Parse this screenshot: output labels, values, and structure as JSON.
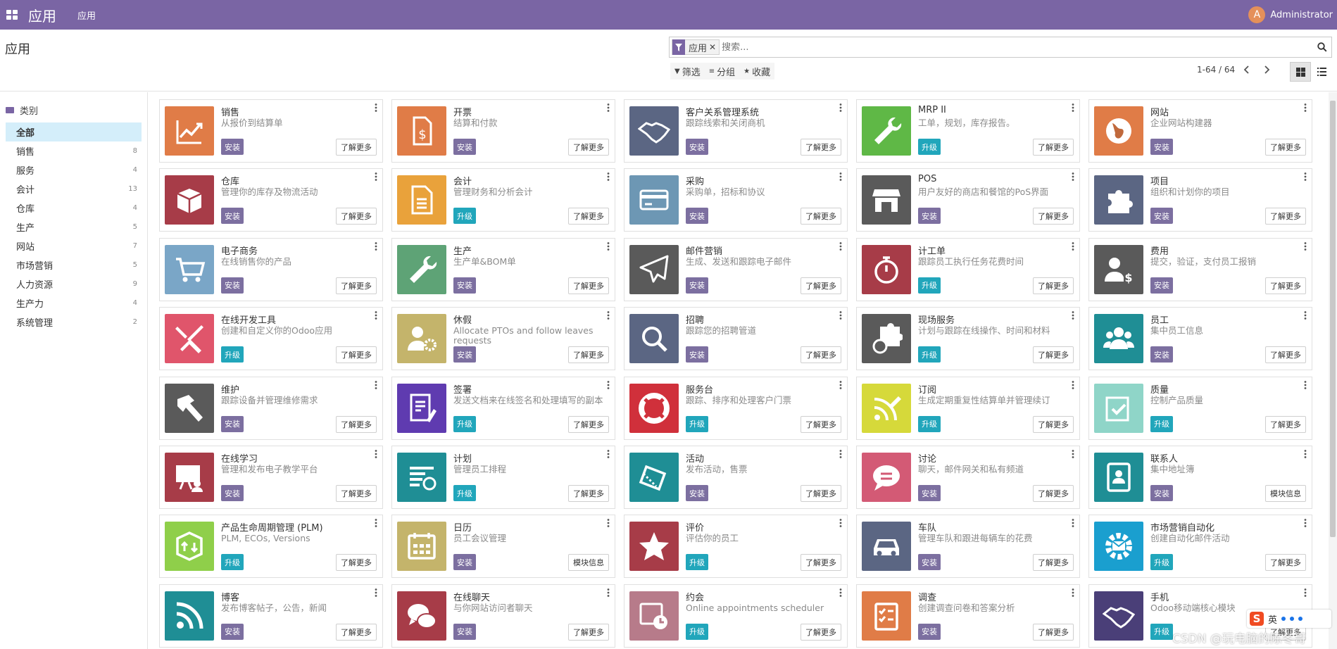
{
  "navbar": {
    "brand": "应用",
    "menu": "应用",
    "user_initial": "A",
    "user_name": "Administrator"
  },
  "control_panel": {
    "title": "应用",
    "facet_label": "应用",
    "facet_close": "✕",
    "search_placeholder": "搜索...",
    "filters": [
      {
        "icon": "▼",
        "label": "筛选"
      },
      {
        "icon": "≡",
        "label": "分组"
      },
      {
        "icon": "★",
        "label": "收藏"
      }
    ],
    "pager": "1-64 / 64"
  },
  "sidebar": {
    "header": "类别",
    "items": [
      {
        "label": "全部",
        "count": ""
      },
      {
        "label": "销售",
        "count": "8"
      },
      {
        "label": "服务",
        "count": "4"
      },
      {
        "label": "会计",
        "count": "13"
      },
      {
        "label": "仓库",
        "count": "4"
      },
      {
        "label": "生产",
        "count": "5"
      },
      {
        "label": "网站",
        "count": "7"
      },
      {
        "label": "市场营销",
        "count": "5"
      },
      {
        "label": "人力资源",
        "count": "9"
      },
      {
        "label": "生产力",
        "count": "4"
      },
      {
        "label": "系统管理",
        "count": "2"
      }
    ]
  },
  "apps": [
    {
      "name": "销售",
      "desc": "从报价到结算单",
      "action": "安装",
      "link": "了解更多",
      "icon": "chart-trend-icon",
      "color": "#e07c47"
    },
    {
      "name": "开票",
      "desc": "结算和付款",
      "action": "安装",
      "link": "了解更多",
      "icon": "invoice-dollar-icon",
      "color": "#e07c47"
    },
    {
      "name": "客户关系管理系统",
      "desc": "跟踪线索和关闭商机",
      "action": "安装",
      "link": "了解更多",
      "icon": "handshake-icon",
      "color": "#5b6683"
    },
    {
      "name": "MRP II",
      "desc": "工单，规划，库存报告。",
      "action": "升级",
      "link": "了解更多",
      "icon": "wrench-icon",
      "color": "#5fb846"
    },
    {
      "name": "网站",
      "desc": "企业网站构建器",
      "action": "安装",
      "link": "了解更多",
      "icon": "globe-icon",
      "color": "#e07c47"
    },
    {
      "name": "仓库",
      "desc": "管理你的库存及物流活动",
      "action": "安装",
      "link": "了解更多",
      "icon": "box-icon",
      "color": "#a73c48"
    },
    {
      "name": "会计",
      "desc": "管理财务和分析会计",
      "action": "升级",
      "link": "了解更多",
      "icon": "document-icon",
      "color": "#e9a23b"
    },
    {
      "name": "采购",
      "desc": "采购单，招标和协议",
      "action": "安装",
      "link": "了解更多",
      "icon": "credit-card-icon",
      "color": "#6d97b4"
    },
    {
      "name": "POS",
      "desc": "用户友好的商店和餐馆的PoS界面",
      "action": "安装",
      "link": "了解更多",
      "icon": "shop-icon",
      "color": "#5a5a5a"
    },
    {
      "name": "项目",
      "desc": "组织和计划你的项目",
      "action": "安装",
      "link": "了解更多",
      "icon": "puzzle-icon",
      "color": "#5b6683"
    },
    {
      "name": "电子商务",
      "desc": "在线销售你的产品",
      "action": "安装",
      "link": "了解更多",
      "icon": "shopping-cart-icon",
      "color": "#7aa6c7"
    },
    {
      "name": "生产",
      "desc": "生产单&BOM单",
      "action": "安装",
      "link": "了解更多",
      "icon": "wrench-icon",
      "color": "#5ea376"
    },
    {
      "name": "邮件营销",
      "desc": "生成、发送和跟踪电子邮件",
      "action": "安装",
      "link": "了解更多",
      "icon": "paper-plane-icon",
      "color": "#5a5a5a"
    },
    {
      "name": "计工单",
      "desc": "跟踪员工执行任务花费时间",
      "action": "升级",
      "link": "了解更多",
      "icon": "stopwatch-icon",
      "color": "#a73c48"
    },
    {
      "name": "费用",
      "desc": "提交，验证，支付员工报销",
      "action": "安装",
      "link": "了解更多",
      "icon": "user-dollar-icon",
      "color": "#5a5a5a"
    },
    {
      "name": "在线开发工具",
      "desc": "创建和自定义你的Odoo应用",
      "action": "升级",
      "link": "了解更多",
      "icon": "tools-icon",
      "color": "#e0556b"
    },
    {
      "name": "休假",
      "desc": "Allocate PTOs and follow leaves requests",
      "action": "安装",
      "link": "了解更多",
      "icon": "user-gear-icon",
      "color": "#c4b46b"
    },
    {
      "name": "招聘",
      "desc": "跟踪您的招聘管道",
      "action": "安装",
      "link": "了解更多",
      "icon": "magnifier-icon",
      "color": "#5b6683"
    },
    {
      "name": "现场服务",
      "desc": "计划与跟踪在线操作、时间和材料",
      "action": "升级",
      "link": "了解更多",
      "icon": "puzzle-clock-icon",
      "color": "#5a5a5a"
    },
    {
      "name": "员工",
      "desc": "集中员工信息",
      "action": "安装",
      "link": "了解更多",
      "icon": "users-icon",
      "color": "#1f8e95"
    },
    {
      "name": "维护",
      "desc": "跟踪设备并管理维修需求",
      "action": "安装",
      "link": "了解更多",
      "icon": "hammer-icon",
      "color": "#5a5a5a"
    },
    {
      "name": "签署",
      "desc": "发送文档来在线签名和处理填写的副本",
      "action": "升级",
      "link": "了解更多",
      "icon": "sign-document-icon",
      "color": "#5f3bb0"
    },
    {
      "name": "服务台",
      "desc": "跟踪、排序和处理客户门票",
      "action": "升级",
      "link": "了解更多",
      "icon": "lifebuoy-icon",
      "color": "#d0303b"
    },
    {
      "name": "订阅",
      "desc": "生成定期重复性结算单并管理续订",
      "action": "升级",
      "link": "了解更多",
      "icon": "rss-pencil-icon",
      "color": "#d6d93a"
    },
    {
      "name": "质量",
      "desc": "控制产品质量",
      "action": "升级",
      "link": "了解更多",
      "icon": "quality-check-icon",
      "color": "#8fd5c8"
    },
    {
      "name": "在线学习",
      "desc": "管理和发布电子教学平台",
      "action": "安装",
      "link": "了解更多",
      "icon": "presentation-icon",
      "color": "#a73c48"
    },
    {
      "name": "计划",
      "desc": "管理员工排程",
      "action": "升级",
      "link": "了解更多",
      "icon": "planning-icon",
      "color": "#1f8e95"
    },
    {
      "name": "活动",
      "desc": "发布活动，售票",
      "action": "安装",
      "link": "了解更多",
      "icon": "ticket-icon",
      "color": "#1f8e95"
    },
    {
      "name": "讨论",
      "desc": "聊天，邮件网关和私有频道",
      "action": "安装",
      "link": "了解更多",
      "icon": "chat-bubble-icon",
      "color": "#d35a75"
    },
    {
      "name": "联系人",
      "desc": "集中地址簿",
      "action": "安装",
      "link": "模块信息",
      "icon": "address-book-icon",
      "color": "#1f8e95"
    },
    {
      "name": "产品生命周期管理 (PLM)",
      "desc": "PLM, ECOs, Versions",
      "action": "升级",
      "link": "了解更多",
      "icon": "cube-arrows-icon",
      "color": "#8fcf4a"
    },
    {
      "name": "日历",
      "desc": "员工会议管理",
      "action": "安装",
      "link": "模块信息",
      "icon": "calendar-icon",
      "color": "#c4b46b"
    },
    {
      "name": "评价",
      "desc": "评估你的员工",
      "action": "升级",
      "link": "了解更多",
      "icon": "star-icon",
      "color": "#a73c48"
    },
    {
      "name": "车队",
      "desc": "管理车队和跟进每辆车的花费",
      "action": "安装",
      "link": "了解更多",
      "icon": "car-icon",
      "color": "#5b6683"
    },
    {
      "name": "市场营销自动化",
      "desc": "创建自动化邮件活动",
      "action": "升级",
      "link": "了解更多",
      "icon": "gear-mail-icon",
      "color": "#1a9fcf"
    },
    {
      "name": "博客",
      "desc": "发布博客帖子，公告，新闻",
      "action": "安装",
      "link": "了解更多",
      "icon": "rss-icon",
      "color": "#1f8e95"
    },
    {
      "name": "在线聊天",
      "desc": "与你网站访问者聊天",
      "action": "安装",
      "link": "了解更多",
      "icon": "chat-bubbles-icon",
      "color": "#a73c48"
    },
    {
      "name": "约会",
      "desc": "Online appointments scheduler",
      "action": "升级",
      "link": "了解更多",
      "icon": "calendar-clock-icon",
      "color": "#b77b8a"
    },
    {
      "name": "调查",
      "desc": "创建调查问卷和答案分析",
      "action": "安装",
      "link": "了解更多",
      "icon": "survey-icon",
      "color": "#e07c47"
    },
    {
      "name": "手机",
      "desc": "Odoo移动端核心模块",
      "action": "升级",
      "link": "了解更多",
      "icon": "handshake-icon",
      "color": "#4a3f78"
    }
  ],
  "overlay": {
    "watermark": "CSDN @玩电脑的陈冬哥",
    "ime_logo": "S",
    "ime_lang": "英"
  }
}
